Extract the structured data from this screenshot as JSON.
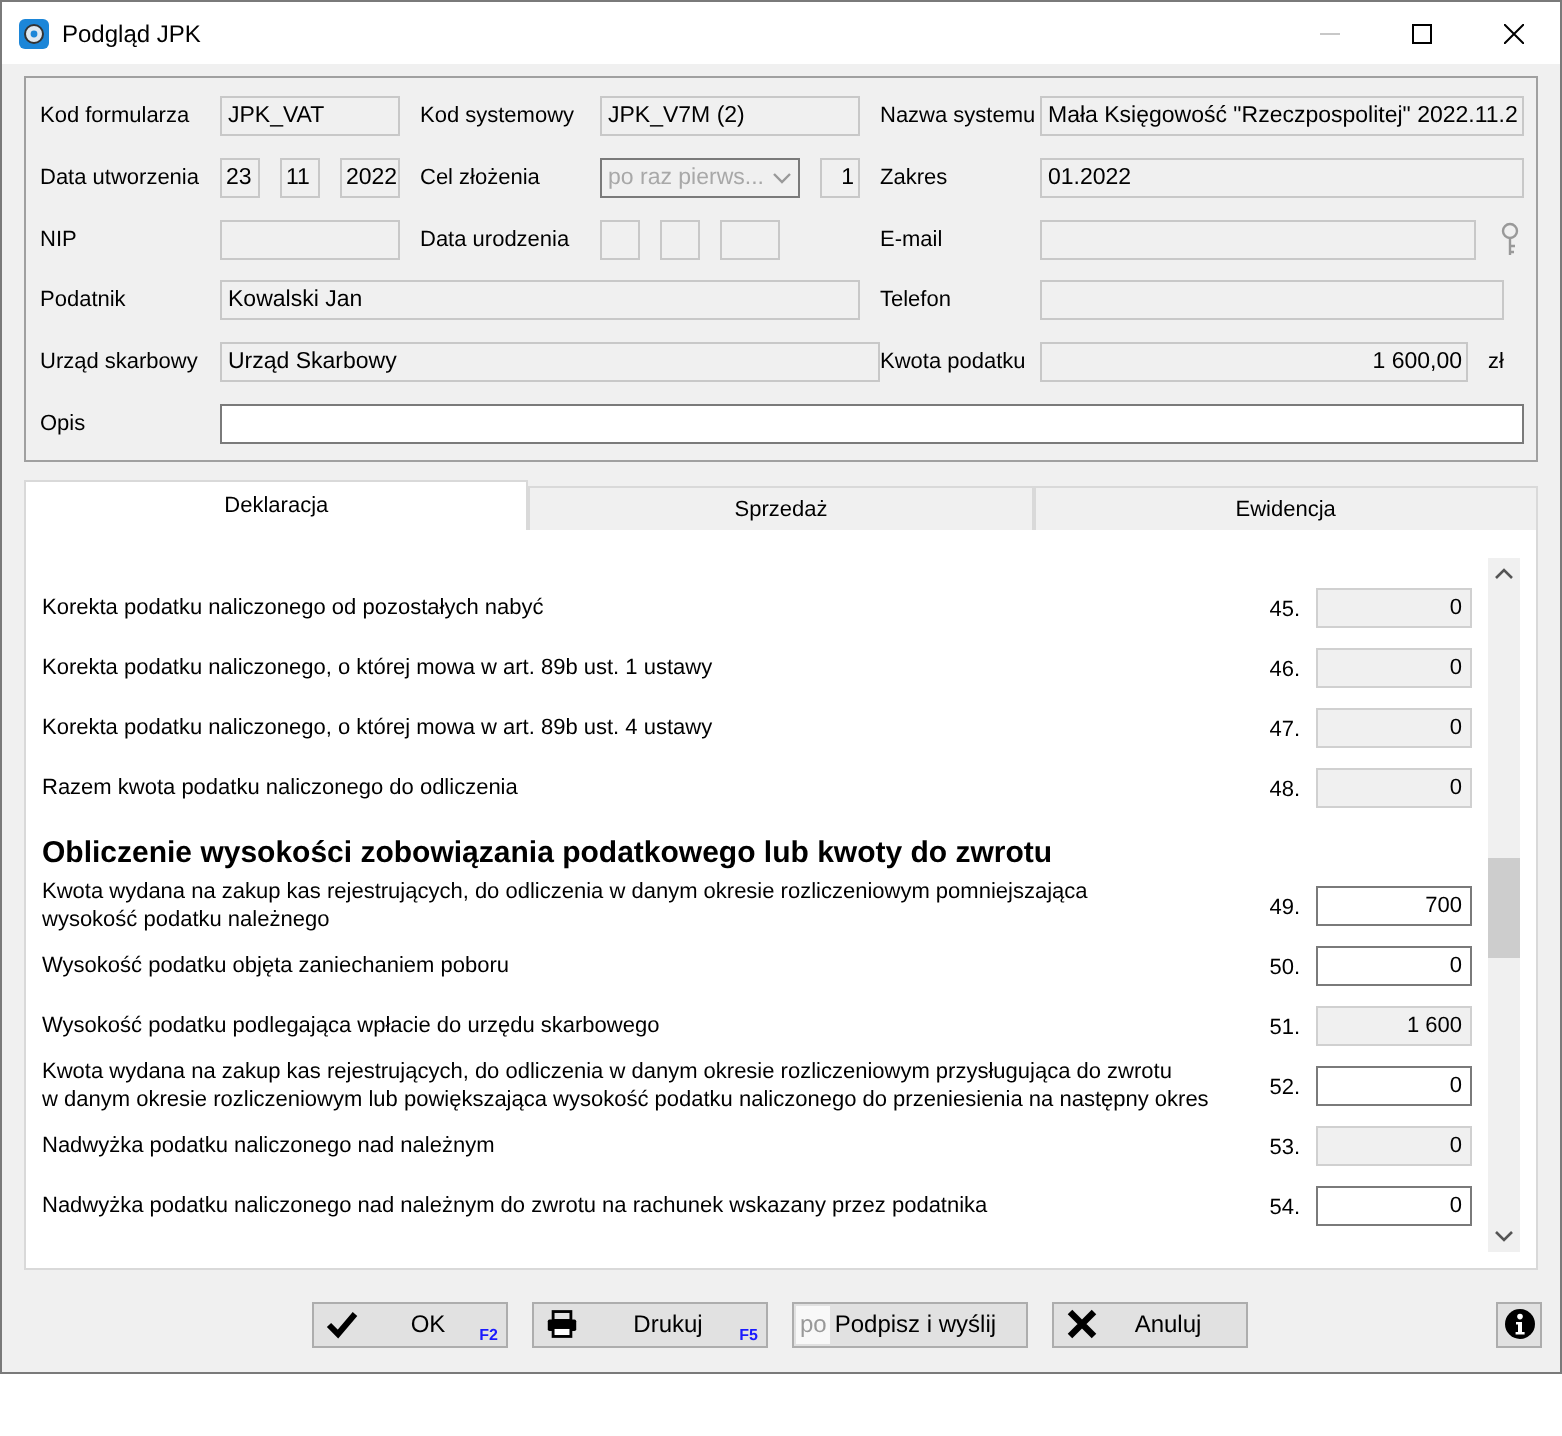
{
  "window": {
    "title": "Podgląd JPK",
    "minimize_disabled": true
  },
  "header_rows": [
    [
      {
        "label": "Kod formularza",
        "fields": [
          {
            "kind": "text",
            "value": "JPK_VAT",
            "readonly": true
          }
        ]
      },
      {
        "label": "Kod systemowy",
        "fields": [
          {
            "kind": "text",
            "value": "JPK_V7M (2)",
            "readonly": true
          }
        ]
      },
      {
        "label": "Nazwa systemu",
        "fields": [
          {
            "kind": "text",
            "value": "Mała Księgowość \"Rzeczpospolitej\" 2022.11.2",
            "readonly": true
          }
        ]
      }
    ],
    [
      {
        "label": "Data utworzenia",
        "fields": [
          {
            "kind": "text",
            "value": "23",
            "readonly": true
          },
          {
            "kind": "text",
            "value": "11",
            "readonly": true
          },
          {
            "kind": "text",
            "value": "2022",
            "readonly": true
          }
        ]
      },
      {
        "label": "Cel złożenia",
        "fields": [
          {
            "kind": "combo",
            "value": "po raz pierws...",
            "disabled": true
          },
          {
            "kind": "number",
            "value": "1",
            "readonly": true
          }
        ]
      },
      {
        "label": "Zakres",
        "fields": [
          {
            "kind": "text",
            "value": "01.2022",
            "readonly": true
          }
        ]
      }
    ],
    [
      {
        "label": "NIP",
        "fields": [
          {
            "kind": "text",
            "readonly": true
          }
        ]
      },
      {
        "label": "Data urodzenia",
        "fields": [
          {
            "kind": "text",
            "readonly": true
          },
          {
            "kind": "text",
            "readonly": true
          },
          {
            "kind": "text",
            "readonly": true
          }
        ]
      },
      {
        "label": "E-mail",
        "fields": [
          {
            "kind": "text",
            "readonly": true
          },
          {
            "kind": "key"
          }
        ]
      }
    ],
    [
      {
        "label": "Podatnik",
        "fields": [
          {
            "kind": "text",
            "value": "Kowalski Jan",
            "readonly": true
          }
        ]
      },
      {
        "label": "Telefon",
        "fields": [
          {
            "kind": "text",
            "readonly": true
          }
        ]
      }
    ],
    [
      {
        "label": "Urząd skarbowy",
        "fields": [
          {
            "kind": "text",
            "value": "Urząd Skarbowy",
            "readonly": true
          }
        ]
      },
      {
        "label": "Kwota podatku",
        "fields": [
          {
            "kind": "number",
            "value": "1 600,00",
            "readonly": true
          },
          {
            "kind": "unit",
            "value": "zł"
          }
        ]
      }
    ],
    [
      {
        "label": "Opis",
        "fields": [
          {
            "kind": "text",
            "readonly": false
          }
        ]
      }
    ]
  ],
  "tabs": [
    {
      "label": "Deklaracja",
      "selected": true
    },
    {
      "label": "Sprzedaż",
      "selected": false
    },
    {
      "label": "Ewidencja",
      "selected": false
    }
  ],
  "deklaracja": {
    "rows": [
      {
        "kind": "row",
        "label": "Korekta podatku naliczonego od pozostałych nabyć",
        "number": "45.",
        "value": "0",
        "readonly": true
      },
      {
        "kind": "row",
        "label": "Korekta podatku naliczonego, o której mowa w art. 89b ust. 1 ustawy",
        "number": "46.",
        "value": "0",
        "readonly": true
      },
      {
        "kind": "row",
        "label": "Korekta podatku naliczonego, o której mowa w art. 89b ust. 4 ustawy",
        "number": "47.",
        "value": "0",
        "readonly": true
      },
      {
        "kind": "row",
        "label": "Razem kwota podatku naliczonego do odliczenia",
        "number": "48.",
        "value": "0",
        "readonly": true
      },
      {
        "kind": "heading",
        "label": "Obliczenie wysokości zobowiązania podatkowego lub kwoty do zwrotu"
      },
      {
        "kind": "row",
        "label": "Kwota wydana na zakup kas rejestrujących, do odliczenia w danym okresie rozliczeniowym pomniejszająca\nwysokość podatku należnego",
        "number": "49.",
        "value": "700",
        "readonly": false
      },
      {
        "kind": "row",
        "label": "Wysokość podatku objęta zaniechaniem poboru",
        "number": "50.",
        "value": "0",
        "readonly": false
      },
      {
        "kind": "row",
        "label": "Wysokość podatku podlegająca wpłacie do urzędu skarbowego",
        "number": "51.",
        "value": "1 600",
        "readonly": true
      },
      {
        "kind": "row",
        "label": "Kwota wydana na zakup kas rejestrujących, do odliczenia w danym okresie rozliczeniowym przysługująca do zwrotu\nw danym okresie rozliczeniowym lub powiększająca wysokość podatku naliczonego do przeniesienia na następny okres",
        "number": "52.",
        "value": "0",
        "readonly": false
      },
      {
        "kind": "row",
        "label": "Nadwyżka podatku naliczonego nad należnym",
        "number": "53.",
        "value": "0",
        "readonly": true
      },
      {
        "kind": "row",
        "label": "Nadwyżka podatku naliczonego nad należnym do zwrotu na rachunek wskazany przez podatnika",
        "number": "54.",
        "value": "0",
        "readonly": false
      }
    ]
  },
  "buttons": [
    {
      "kind": "ok",
      "label": "OK",
      "shortcut": "F2"
    },
    {
      "kind": "print",
      "label": "Drukuj",
      "shortcut": "F5"
    },
    {
      "kind": "sign",
      "label": "Podpisz i wyślij",
      "badge": "po"
    },
    {
      "kind": "cancel",
      "label": "Anuluj"
    },
    {
      "kind": "info"
    }
  ]
}
